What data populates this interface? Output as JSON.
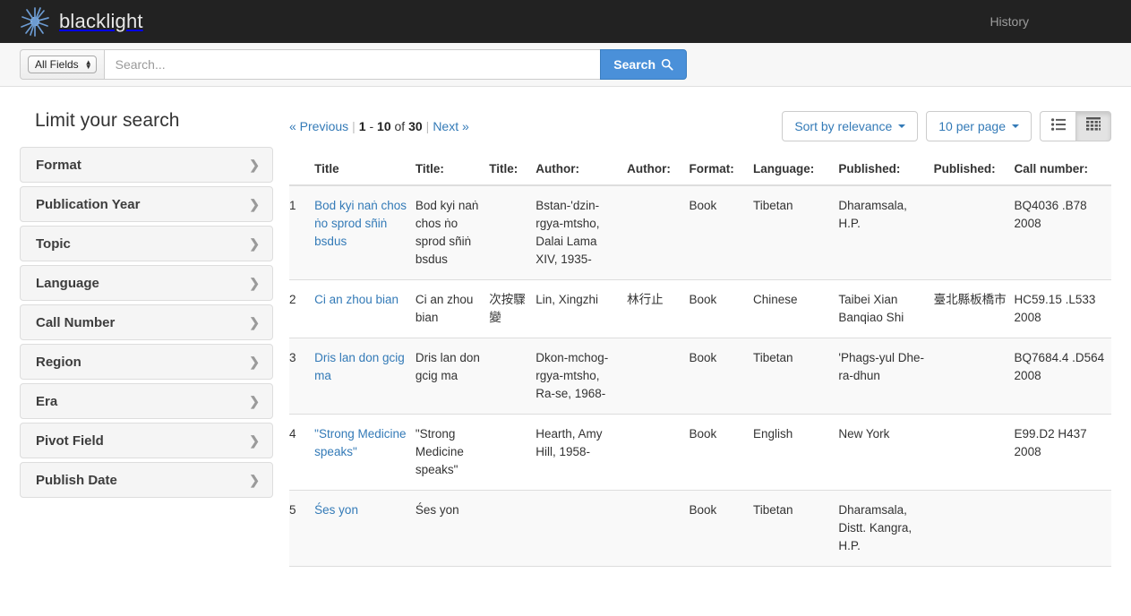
{
  "navbar": {
    "brand": "blacklight",
    "logo_icon": "sun-burst-logo",
    "links": [
      {
        "label": "History",
        "name": "nav-link-history"
      }
    ]
  },
  "search": {
    "field_selector_value": "All Fields",
    "placeholder": "Search...",
    "value": "",
    "button_label": "Search",
    "button_icon": "search-icon"
  },
  "sidebar": {
    "heading": "Limit your search",
    "items": [
      {
        "label": "Format"
      },
      {
        "label": "Publication Year"
      },
      {
        "label": "Topic"
      },
      {
        "label": "Language"
      },
      {
        "label": "Call Number"
      },
      {
        "label": "Region"
      },
      {
        "label": "Era"
      },
      {
        "label": "Pivot Field"
      },
      {
        "label": "Publish Date"
      }
    ],
    "arrow_icon": "chevron-right-icon"
  },
  "toolbar": {
    "previous_label": "« Previous",
    "range_start": "1",
    "range_dash": "-",
    "range_end": "10",
    "of_label": "of",
    "total": "30",
    "next_label": "Next »",
    "sort_label": "Sort by relevance",
    "per_page_label": "10 per page",
    "list_view_icon": "list-view-icon",
    "table_view_icon": "table-view-icon",
    "active_view": "table"
  },
  "results_table": {
    "columns": [
      "",
      "Title",
      "Title:",
      "Title:",
      "Author:",
      "Author:",
      "Format:",
      "Language:",
      "Published:",
      "Published:",
      "Call number:"
    ],
    "rows": [
      {
        "num": "1",
        "title_link": "Bod kyi naṅ chos ṅo sprod sñiṅ bsdus",
        "title_2": "Bod kyi naṅ chos ṅo sprod sñiṅ bsdus",
        "title_3": "",
        "author_1": "Bstan-'dzin-rgya-mtsho, Dalai Lama XIV, 1935-",
        "author_2": "",
        "format": "Book",
        "language": "Tibetan",
        "published_1": "Dharamsala, H.P.",
        "published_2": "",
        "call_number": "BQ4036 .B78 2008"
      },
      {
        "num": "2",
        "title_link": "Ci an zhou bian",
        "title_2": "Ci an zhou bian",
        "title_3": "次按驟變",
        "author_1": "Lin, Xingzhi",
        "author_2": "林行止",
        "format": "Book",
        "language": "Chinese",
        "published_1": "Taibei Xian Banqiao Shi",
        "published_2": "臺北縣板橋市",
        "call_number": "HC59.15 .L533 2008"
      },
      {
        "num": "3",
        "title_link": "Dris lan don gcig ma",
        "title_2": "Dris lan don gcig ma",
        "title_3": "",
        "author_1": "Dkon-mchog-rgya-mtsho, Ra-se, 1968-",
        "author_2": "",
        "format": "Book",
        "language": "Tibetan",
        "published_1": "'Phags-yul Dhe-ra-dhun",
        "published_2": "",
        "call_number": "BQ7684.4 .D564 2008"
      },
      {
        "num": "4",
        "title_link": "\"Strong Medicine speaks\"",
        "title_2": "\"Strong Medicine speaks\"",
        "title_3": "",
        "author_1": "Hearth, Amy Hill, 1958-",
        "author_2": "",
        "format": "Book",
        "language": "English",
        "published_1": "New York",
        "published_2": "",
        "call_number": "E99.D2 H437 2008"
      },
      {
        "num": "5",
        "title_link": "Śes yon",
        "title_2": "Śes yon",
        "title_3": "",
        "author_1": "",
        "author_2": "",
        "format": "Book",
        "language": "Tibetan",
        "published_1": "Dharamsala, Distt. Kangra, H.P.",
        "published_2": "",
        "call_number": ""
      }
    ]
  },
  "colors": {
    "navbar_bg": "#222222",
    "link": "#337ab7",
    "search_button": "#4a90d9",
    "facet_bg": "#f5f5f5",
    "logo": "#5b8bc4"
  }
}
